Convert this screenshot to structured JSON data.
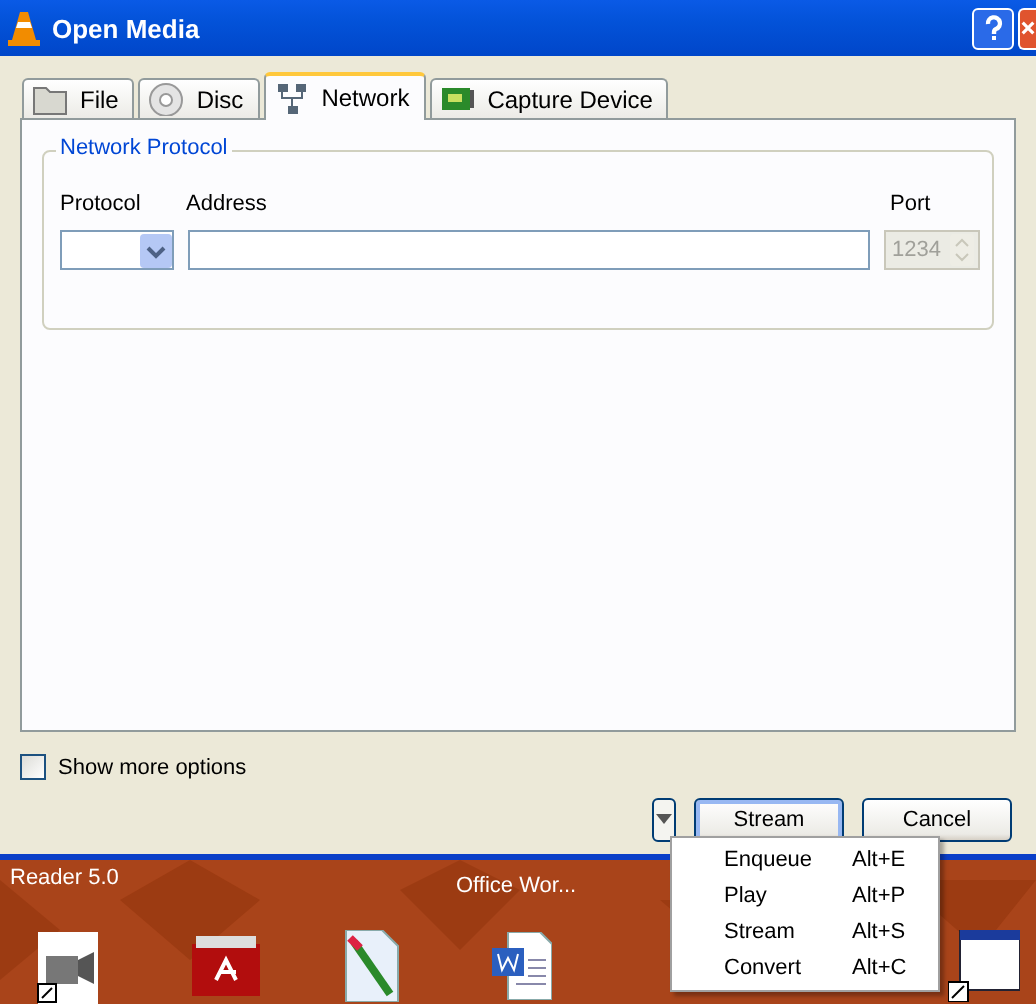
{
  "window": {
    "title": "Open Media"
  },
  "tabs": [
    {
      "label": "File",
      "selected": false
    },
    {
      "label": "Disc",
      "selected": false
    },
    {
      "label": "Network",
      "selected": true
    },
    {
      "label": "Capture Device",
      "selected": false
    }
  ],
  "network_protocol": {
    "title": "Network Protocol",
    "protocol_label": "Protocol",
    "address_label": "Address",
    "port_label": "Port",
    "port_value": "1234",
    "port_disabled": true
  },
  "show_more_options": {
    "label": "Show more options",
    "checked": false
  },
  "buttons": [
    {
      "label": "Stream",
      "kind": "default"
    },
    {
      "label": "Cancel",
      "kind": "normal"
    }
  ],
  "menu": [
    {
      "label": "Enqueue",
      "shortcut": "Alt+E"
    },
    {
      "label": "Play",
      "shortcut": "Alt+P"
    },
    {
      "label": "Stream",
      "shortcut": "Alt+S"
    },
    {
      "label": "Convert",
      "shortcut": "Alt+C"
    }
  ],
  "desktop": {
    "labels": [
      "Reader 5.0",
      "Office Wor..."
    ]
  }
}
